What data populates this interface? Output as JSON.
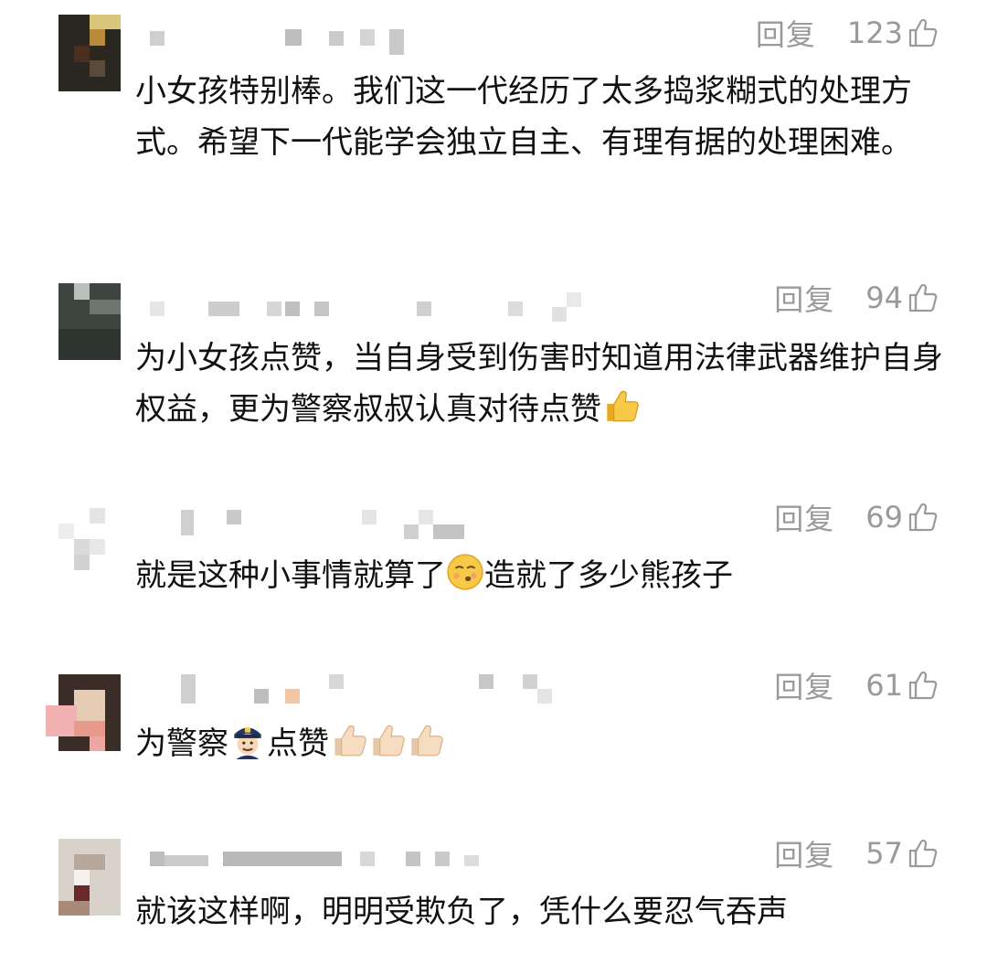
{
  "comments": [
    {
      "reply_label": "回复",
      "likes": "123",
      "text": "小女孩特别棒。我们这一代经历了太多捣浆糊式的处理方式。希望下一代能学会独立自主、有理有据的处理困难。",
      "emoji": []
    },
    {
      "reply_label": "回复",
      "likes": "94",
      "text": "为小女孩点赞，当自身受到伤害时知道用法律武器维护自身权益，更为警察叔叔认真对待点赞",
      "emoji": [
        "thumbs-up"
      ]
    },
    {
      "reply_label": "回复",
      "likes": "69",
      "text_before": "就是这种小事情就算了",
      "text_after": "造就了多少熊孩子",
      "emoji": [
        "sighing-face"
      ]
    },
    {
      "reply_label": "回复",
      "likes": "61",
      "text_before": "为警察",
      "text_after": "点赞",
      "emoji": [
        "police-officer",
        "thumbs-up-light",
        "thumbs-up-light",
        "thumbs-up-light"
      ]
    },
    {
      "reply_label": "回复",
      "likes": "57",
      "text": "就该这样啊，明明受欺负了，凭什么要忍气吞声",
      "emoji": []
    }
  ],
  "icons": {
    "like": "thumbs-up-outline-icon"
  },
  "colors": {
    "meta_gray": "#9a9a9a",
    "text": "#111111",
    "emoji_yellow": "#f5c44a"
  }
}
